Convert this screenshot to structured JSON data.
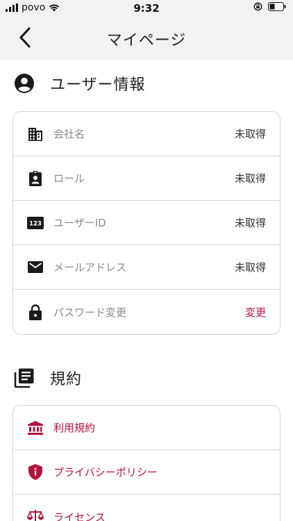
{
  "status_bar": {
    "carrier": "povo",
    "time": "9:32"
  },
  "nav": {
    "title": "マイページ"
  },
  "user_section": {
    "heading": "ユーザー情報",
    "rows": [
      {
        "label": "会社名",
        "value": "未取得",
        "icon": "building-icon"
      },
      {
        "label": "ロール",
        "value": "未取得",
        "icon": "badge-icon"
      },
      {
        "label": "ユーザーID",
        "value": "未取得",
        "icon": "id-123-icon"
      },
      {
        "label": "メールアドレス",
        "value": "未取得",
        "icon": "mail-icon"
      },
      {
        "label": "パスワード変更",
        "value": "変更",
        "icon": "lock-icon"
      }
    ]
  },
  "terms_section": {
    "heading": "規約",
    "rows": [
      {
        "label": "利用規約",
        "icon": "institution-icon"
      },
      {
        "label": "プライバシーポリシー",
        "icon": "shield-info-icon"
      },
      {
        "label": "ライセンス",
        "icon": "scale-icon"
      }
    ]
  },
  "colors": {
    "accent": "#b5123f",
    "header_bg": "#f2f2f2",
    "border": "#d6d6d6"
  }
}
